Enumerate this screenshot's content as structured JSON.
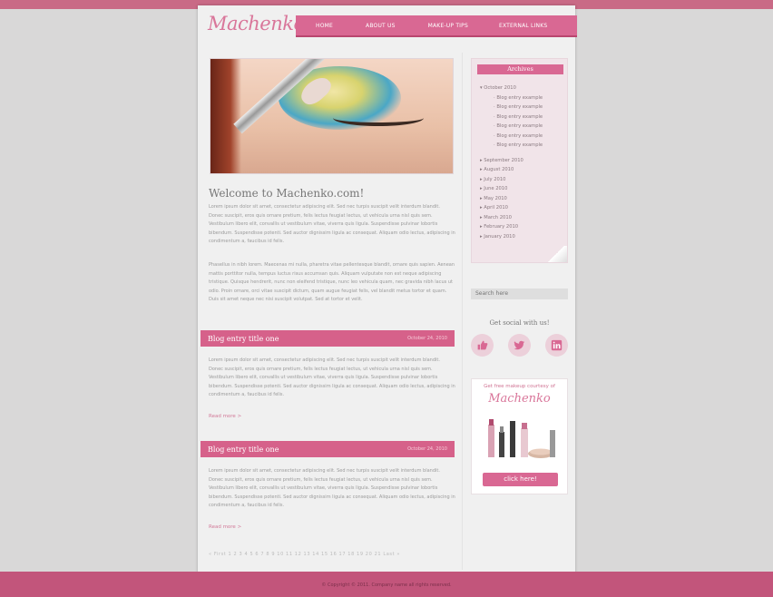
{
  "site": {
    "logo": "Machenko",
    "nav": [
      "HOME",
      "ABOUT US",
      "MAKE-UP TIPS",
      "EXTERNAL LINKS"
    ]
  },
  "main": {
    "welcome_title": "Welcome to Machenko.com!",
    "intro_para1": "Lorem ipsum dolor sit amet, consectetur adipiscing elit. Sed nec turpis suscipit velit interdum blandit. Donec suscipit, eros quis ornare pretium, felis lectus feugiat lectus, ut vehicula urna nisl quis sem. Vestibulum libero elit, convallis ut vestibulum vitae, viverra quis ligula. Suspendisse pulvinar lobortis bibendum. Suspendisse potenti. Sed auctor dignissim ligula ac consequat. Aliquam odio lectus, adipiscing in condimentum a, faucibus id felis.",
    "intro_para2": "Phasellus in nibh lorem. Maecenas mi nulla, pharetra vitae pellentesque blandit, ornare quis sapien. Aenean mattis porttitor nulla, tempus luctus risus accumsan quis. Aliquam vulputate non est neque adipiscing tristique. Quisque hendrerit, nunc non eleifend tristique, nunc leo vehicula quam, nec gravida nibh lacus ut odio. Proin ornare, orci vitae suscipit dictum, quam augue feugiat felis, vel blandit metus tortor et quam. Duis sit amet neque nec nisi suscipit volutpat. Sed at tortor et velit.",
    "entries": [
      {
        "title": "Blog entry title one",
        "date": "October 24, 2010",
        "body": "Lorem ipsum dolor sit amet, consectetur adipiscing elit. Sed nec turpis suscipit velit interdum blandit. Donec suscipit, eros quis ornare pretium, felis lectus feugiat lectus, ut vehicula urna nisl quis sem. Vestibulum libero elit, convallis ut vestibulum vitae, viverra quis ligula. Suspendisse pulvinar lobortis bibendum. Suspendisse potenti. Sed auctor dignissim ligula ac consequat. Aliquam odio lectus, adipiscing in condimentum a, faucibus id felis.",
        "read_more": "Read more >"
      },
      {
        "title": "Blog entry title one",
        "date": "October 24, 2010",
        "body": "Lorem ipsum dolor sit amet, consectetur adipiscing elit. Sed nec turpis suscipit velit interdum blandit. Donec suscipit, eros quis ornare pretium, felis lectus feugiat lectus, ut vehicula urna nisl quis sem. Vestibulum libero elit, convallis ut vestibulum vitae, viverra quis ligula. Suspendisse pulvinar lobortis bibendum. Suspendisse potenti. Sed auctor dignissim ligula ac consequat. Aliquam odio lectus, adipiscing in condimentum a, faucibus id felis.",
        "read_more": "Read more >"
      }
    ],
    "pagination": "« First  1  2  3  4  5  6  7  8  9  10  11  12  13  14  15  16  17  18  19  20  21  Last »"
  },
  "sidebar": {
    "archives_title": "Archives",
    "archives_open": {
      "label": "October 2010",
      "posts": [
        "Blog entry example",
        "Blog entry example",
        "Blog entry example",
        "Blog entry example",
        "Blog entry example",
        "Blog entry example"
      ]
    },
    "archives_months": [
      "September 2010",
      "August 2010",
      "July 2010",
      "June 2010",
      "May 2010",
      "April 2010",
      "March 2010",
      "February 2010",
      "January 2010"
    ],
    "search_placeholder": "Search here",
    "social_heading": "Get social with us!",
    "social_icons": [
      "facebook-like-icon",
      "twitter-icon",
      "linkedin-icon"
    ],
    "ad": {
      "top_text": "Get free makeup courtesy of",
      "brand": "Machenko",
      "button": "click here!"
    }
  },
  "footer": {
    "copyright": "© Copyright © 2011. Company name all rights reserved."
  },
  "colors": {
    "accent": "#d96893",
    "background": "#d9d8d8",
    "footer": "#c2557b"
  }
}
